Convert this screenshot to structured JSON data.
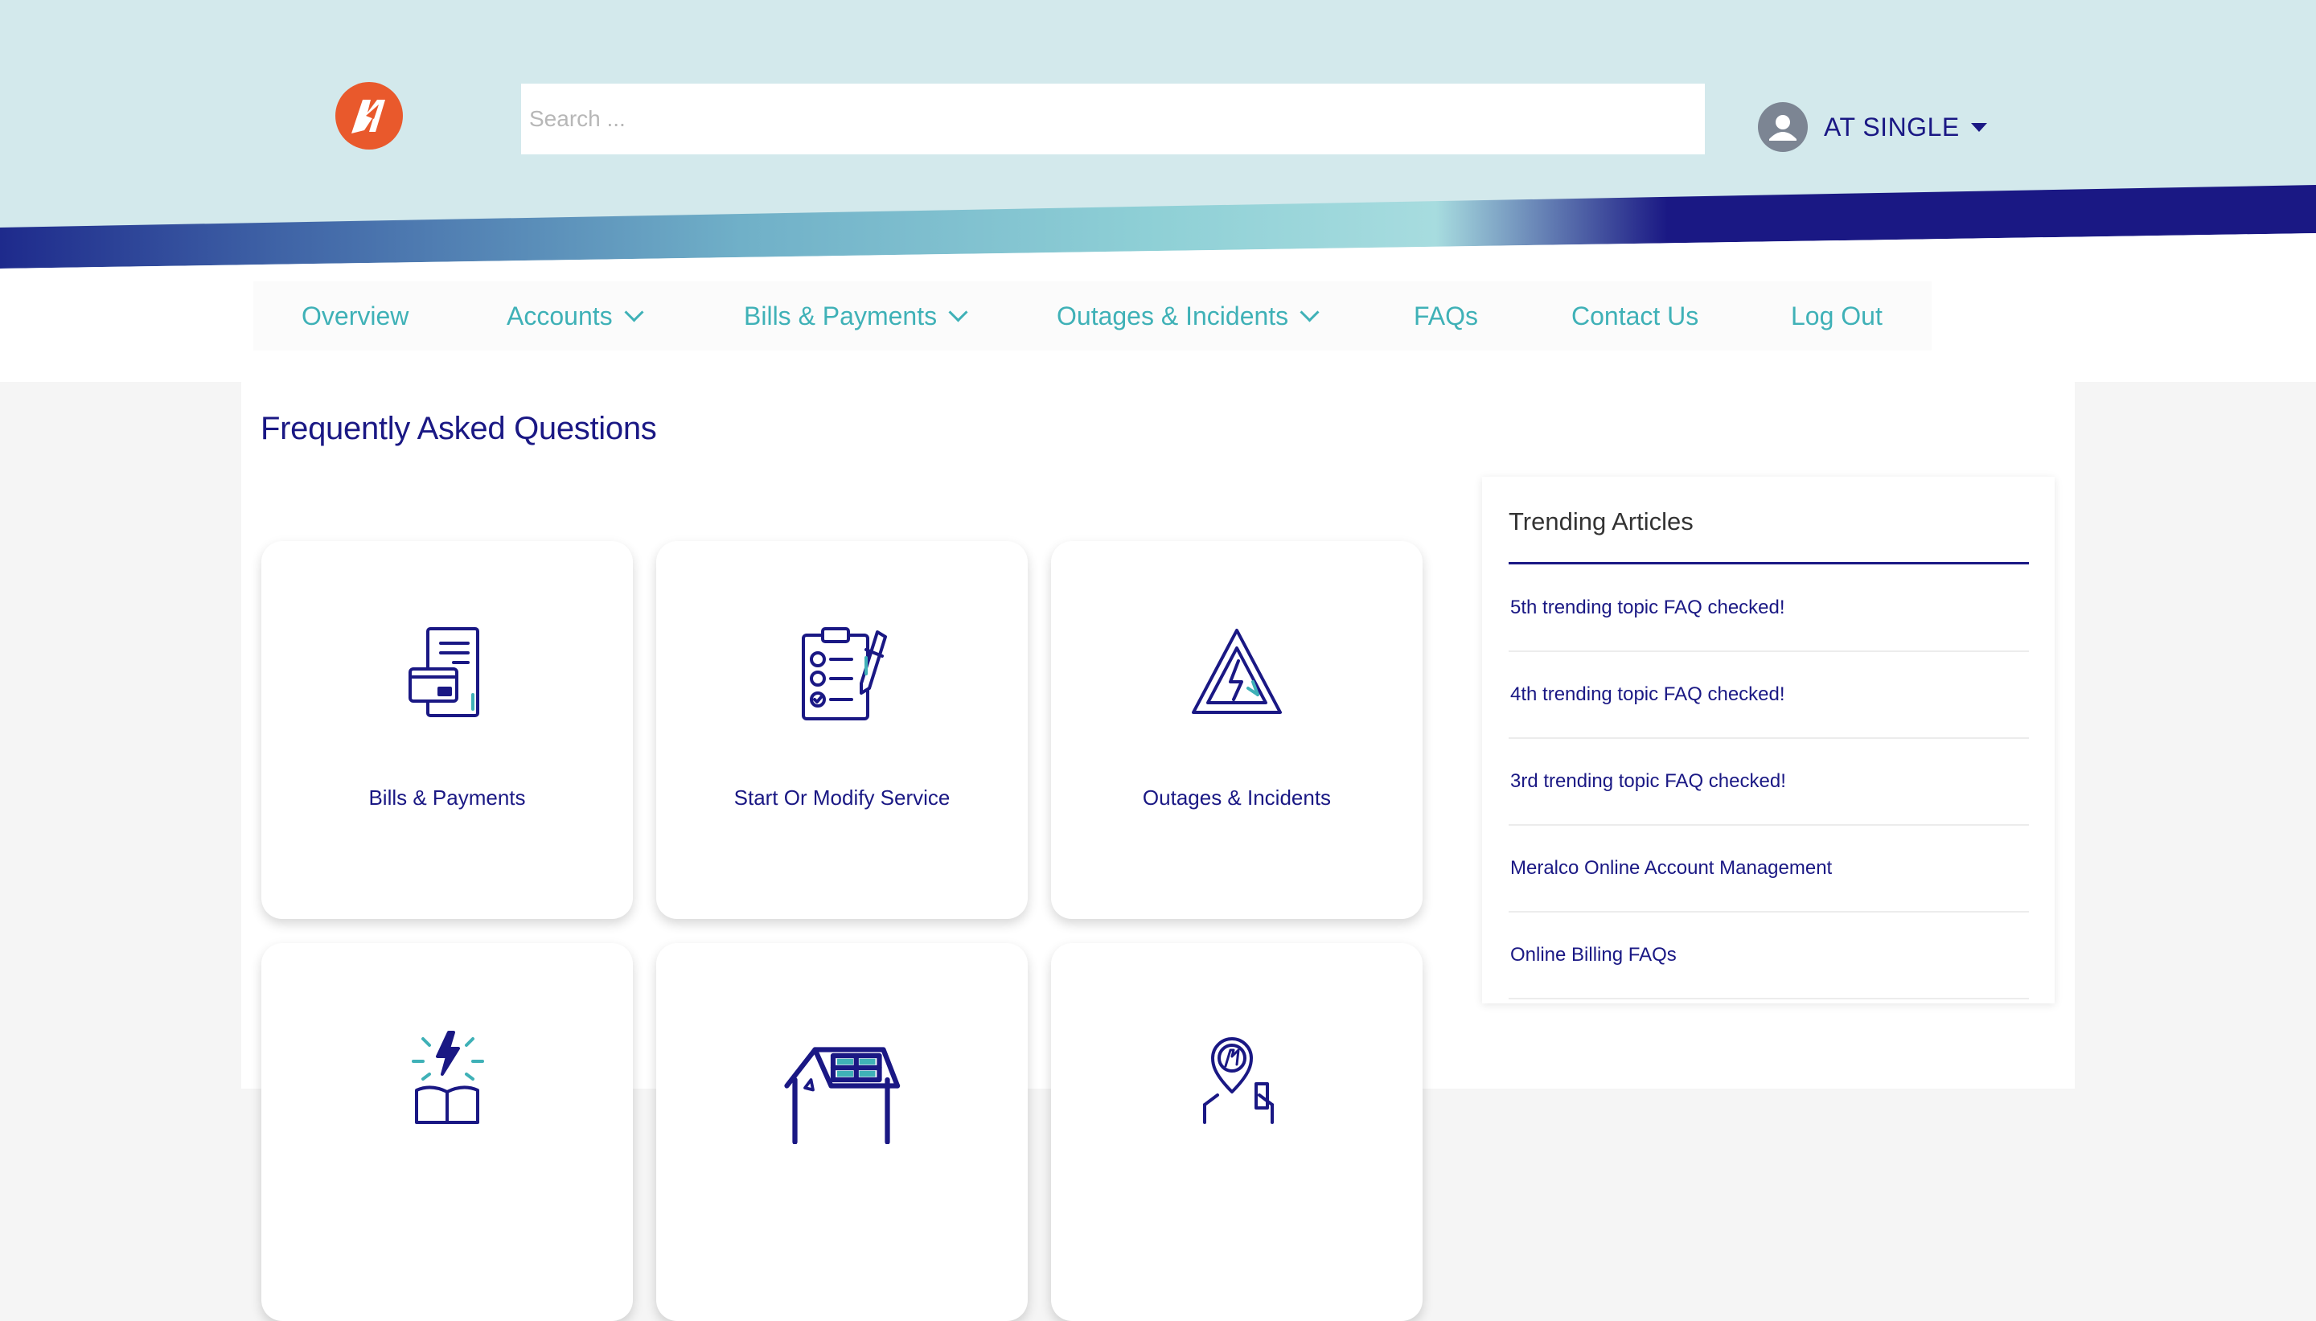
{
  "brand": {
    "logo_icon": "meralco-lightning-logo-icon",
    "logo_color": "#e9592c",
    "primary_color": "#1a1884",
    "accent_color": "#3fb1b7",
    "header_bg": "#d3e9ec"
  },
  "search": {
    "placeholder": "Search ...",
    "value": ""
  },
  "user": {
    "name": "AT SINGLE",
    "icon": "user-avatar-icon"
  },
  "nav": {
    "items": [
      {
        "label": "Overview",
        "dropdown": false
      },
      {
        "label": "Accounts",
        "dropdown": true
      },
      {
        "label": "Bills & Payments",
        "dropdown": true
      },
      {
        "label": "Outages & Incidents",
        "dropdown": true
      },
      {
        "label": "FAQs",
        "dropdown": false
      },
      {
        "label": "Contact Us",
        "dropdown": false
      },
      {
        "label": "Log Out",
        "dropdown": false
      }
    ]
  },
  "main": {
    "title": "Frequently Asked Questions",
    "categories": [
      {
        "label": "Bills & Payments",
        "icon": "bill-card-icon"
      },
      {
        "label": "Start Or Modify Service",
        "icon": "clipboard-checklist-icon"
      },
      {
        "label": "Outages & Incidents",
        "icon": "electric-hazard-icon"
      },
      {
        "label": "",
        "icon": "energy-book-icon"
      },
      {
        "label": "",
        "icon": "house-solar-panel-icon"
      },
      {
        "label": "",
        "icon": "location-pin-icon"
      }
    ]
  },
  "trending": {
    "title": "Trending Articles",
    "items": [
      {
        "label": "5th trending topic FAQ checked!"
      },
      {
        "label": "4th trending topic FAQ checked!"
      },
      {
        "label": "3rd trending topic FAQ checked!"
      },
      {
        "label": "Meralco Online Account Management"
      },
      {
        "label": "Online Billing FAQs"
      }
    ]
  }
}
